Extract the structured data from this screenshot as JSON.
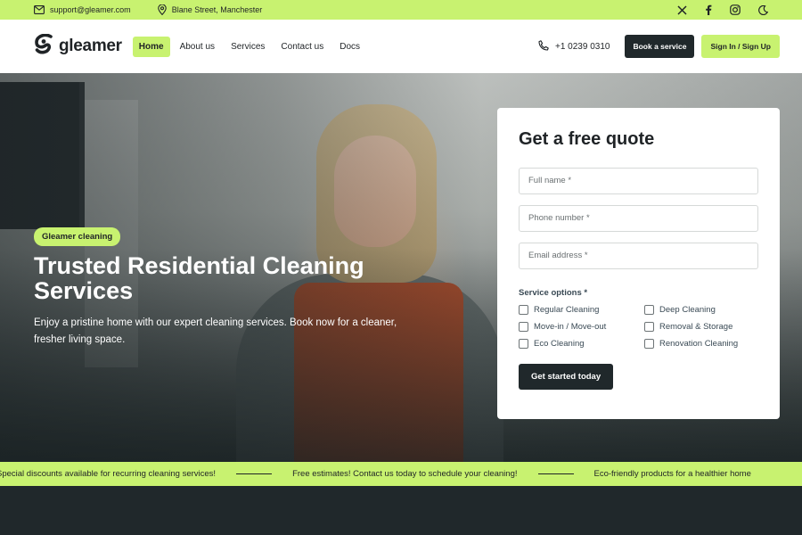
{
  "topbar": {
    "email": "support@gleamer.com",
    "address": "Blane Street, Manchester",
    "social_icons": [
      "x-icon",
      "facebook-icon",
      "instagram-icon",
      "moon-icon"
    ]
  },
  "header": {
    "logo_text": "gleamer",
    "nav": [
      "Home",
      "About us",
      "Services",
      "Contact us",
      "Docs"
    ],
    "active_nav": "Home",
    "phone": "+1 0239 0310",
    "book_label": "Book a service",
    "signin_label": "Sign In / Sign Up"
  },
  "hero": {
    "badge": "Gleamer cleaning",
    "title": "Trusted Residential Cleaning Services",
    "description": "Enjoy a pristine home with our expert cleaning services. Book now for a cleaner, fresher living space."
  },
  "quote": {
    "title": "Get a free quote",
    "fields": {
      "full_name": "Full name *",
      "phone": "Phone number *",
      "email": "Email address *"
    },
    "options_label": "Service options *",
    "options": [
      "Regular Cleaning",
      "Deep Cleaning",
      "Move-in / Move-out",
      "Removal & Storage",
      "Eco Cleaning",
      "Renovation Cleaning"
    ],
    "submit_label": "Get started today"
  },
  "ticker": [
    "Special discounts available for recurring cleaning services!",
    "Free estimates! Contact us today to schedule your cleaning!",
    "Eco-friendly products for a healthier home"
  ],
  "colors": {
    "accent": "#c8f270",
    "dark": "#20282b",
    "apron": "#b5512e"
  }
}
